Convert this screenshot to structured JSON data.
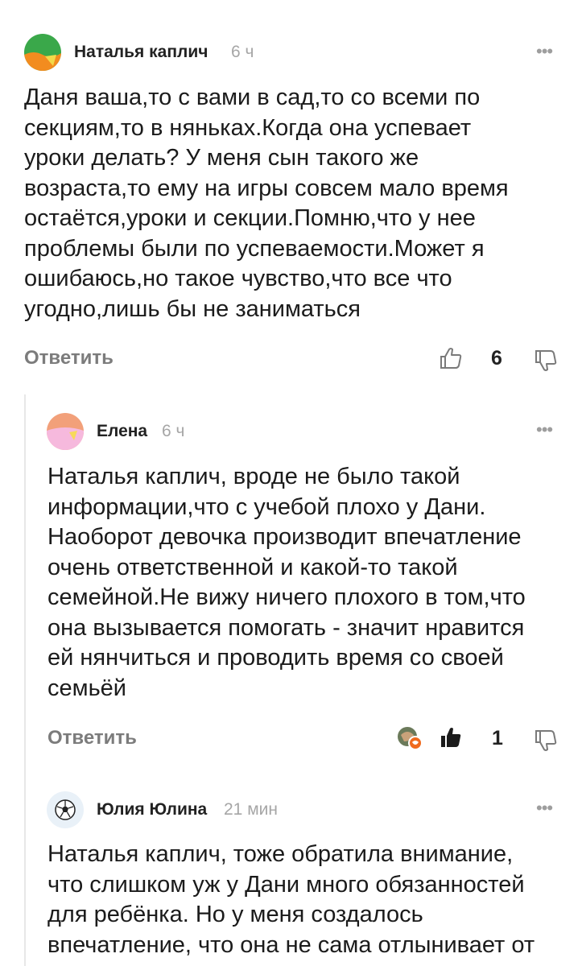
{
  "comments": [
    {
      "author": "Наталья каплич",
      "time": "6 ч",
      "text_lines": [
        "Даня ваша,то с вами в сад,то со всеми по",
        "секциям,то в няньках.Когда она успевает",
        "уроки делать? У меня сын такого же",
        "возраста,то ему на игры совсем мало время",
        "остаётся,уроки и секции.Помню,что у нее",
        "проблемы были по успеваемости.Может я",
        "ошибаюсь,но такое чувство,что все что",
        "угодно,лишь бы не заниматься"
      ],
      "reply_label": "Ответить",
      "likes": "6",
      "avatar_colors": [
        "#3aa84a",
        "#f28c1f",
        "#f3d94a"
      ]
    },
    {
      "author": "Елена",
      "time": "6 ч",
      "text_lines": [
        "Наталья каплич, вроде не было такой",
        "информации,что с учебой плохо у Дани.",
        "Наоборот девочка производит впечатление",
        "очень ответственной и какой-то такой",
        "семейной.Не вижу ничего плохого в том,что",
        "она вызывается помогать - значит нравится",
        "ей нянчиться и проводить время со своей",
        "семьёй"
      ],
      "reply_label": "Ответить",
      "likes": "1",
      "avatar_colors": [
        "#f2a07a",
        "#f6b9dd",
        "#f7d95a"
      ]
    },
    {
      "author": "Юлия Юлина",
      "time": "21 мин",
      "text_lines": [
        "Наталья каплич, тоже обратила внимание,",
        "что слишком уж у Дани много обязанностей",
        "для ребёнка. Но у меня создалось",
        "впечатление, что она не сама отлынивает от"
      ],
      "avatar_icon": "soccer-ball-icon"
    }
  ],
  "icons": {
    "more": "more-dots-icon",
    "like": "thumbs-up-icon",
    "dislike": "thumbs-down-icon",
    "reaction": "reaction-avatars-icon"
  },
  "colors": {
    "text": "#1b1b1b",
    "muted": "#a6a6a6",
    "reply": "#7c7c7c",
    "reaction_accent": "#f06a1e"
  }
}
